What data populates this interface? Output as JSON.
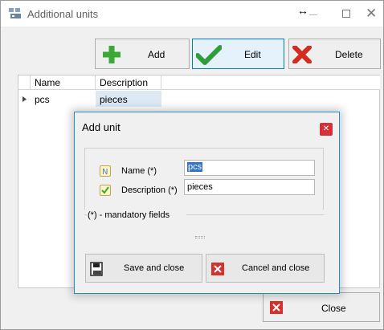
{
  "window": {
    "title": "Additional units",
    "resize_glyph": "↔"
  },
  "toolbar": {
    "add_label": "Add",
    "edit_label": "Edit",
    "delete_label": "Delete"
  },
  "grid": {
    "columns": [
      "Name",
      "Description"
    ],
    "rows": [
      {
        "name": "pcs",
        "description": "pieces"
      }
    ]
  },
  "footer": {
    "close_label": "Close"
  },
  "dialog": {
    "title": "Add unit",
    "name_label": "Name (*)",
    "name_value": "pcs",
    "description_label": "Description (*)",
    "description_value": "pieces",
    "mandatory_note": "(*) - mandatory fields",
    "save_label": "Save and close",
    "cancel_label": "Cancel and close"
  },
  "colors": {
    "add_green": "#3aa935",
    "edit_green": "#2f9e3a",
    "delete_red": "#d42b1e",
    "focus_blue": "#0078d7",
    "selection_blue": "#3173c6"
  },
  "icons": [
    "app-icon",
    "plus-icon",
    "checkmark-icon",
    "x-icon",
    "row-pointer-icon",
    "note-icon",
    "check-doc-icon",
    "save-icon",
    "cancel-icon",
    "close-icon",
    "resize-icon"
  ]
}
